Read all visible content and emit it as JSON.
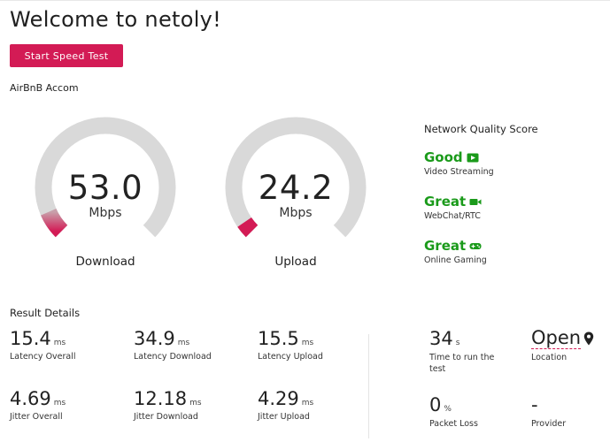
{
  "header": {
    "title": "Welcome to netoly!",
    "start_button": "Start Speed Test"
  },
  "network": {
    "name": "AirBnB Accom"
  },
  "gauges": [
    {
      "value": "53.0",
      "unit": "Mbps",
      "label": "Download",
      "fill_fraction": 0.08
    },
    {
      "value": "24.2",
      "unit": "Mbps",
      "label": "Upload",
      "fill_fraction": 0.04
    }
  ],
  "network_quality": {
    "title": "Network Quality Score",
    "items": [
      {
        "rating": "Good",
        "desc": "Video Streaming",
        "icon": "play-icon"
      },
      {
        "rating": "Great",
        "desc": "WebChat/RTC",
        "icon": "video-camera-icon"
      },
      {
        "rating": "Great",
        "desc": "Online Gaming",
        "icon": "gamepad-icon"
      }
    ]
  },
  "results": {
    "title": "Result Details",
    "metrics": [
      {
        "value": "15.4",
        "unit": "ms",
        "label": "Latency Overall"
      },
      {
        "value": "34.9",
        "unit": "ms",
        "label": "Latency Download"
      },
      {
        "value": "15.5",
        "unit": "ms",
        "label": "Latency Upload"
      },
      {
        "value": "4.69",
        "unit": "ms",
        "label": "Jitter Overall"
      },
      {
        "value": "12.18",
        "unit": "ms",
        "label": "Jitter Download"
      },
      {
        "value": "4.29",
        "unit": "ms",
        "label": "Jitter Upload"
      }
    ],
    "test_time": {
      "value": "34",
      "unit": "s",
      "label": "Time to run the test"
    },
    "location": {
      "value": "Open",
      "label": "Location",
      "icon": "map-pin-icon"
    },
    "packet_loss": {
      "value": "0",
      "unit": "%",
      "label": "Packet Loss"
    },
    "provider": {
      "value": "-",
      "label": "Provider"
    }
  },
  "colors": {
    "accent": "#d31b55",
    "good": "#1a9a1a",
    "track": "#d9d9d9"
  }
}
